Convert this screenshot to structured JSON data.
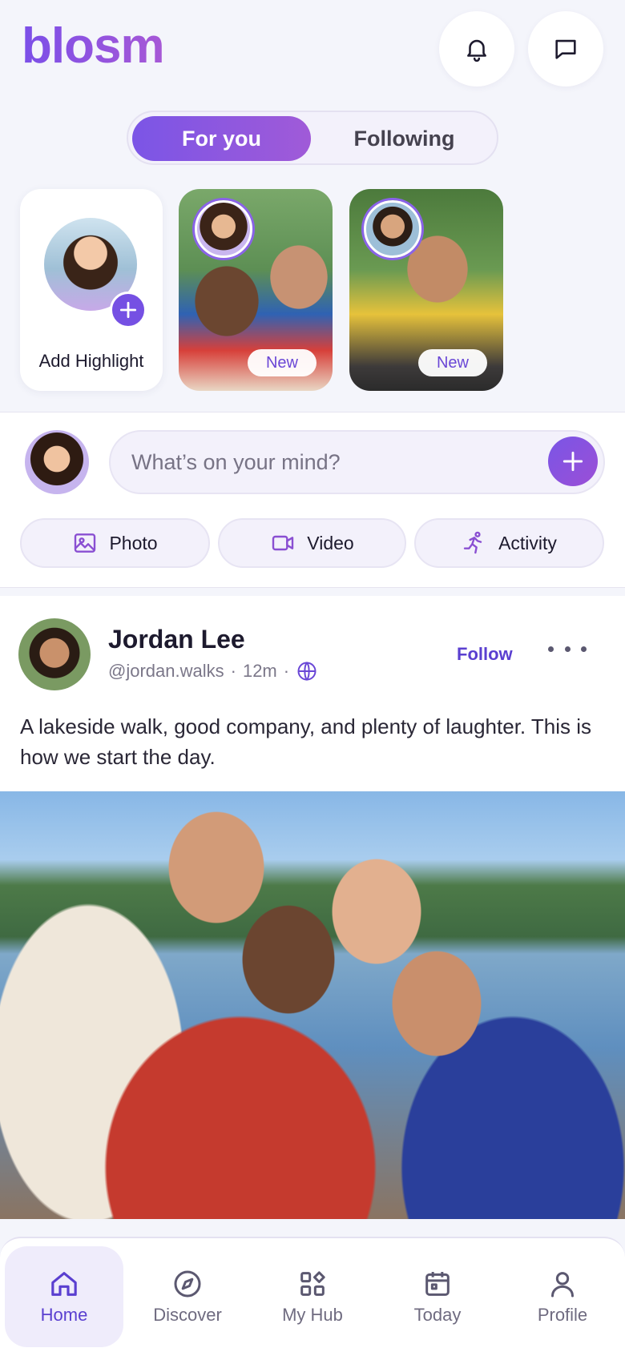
{
  "app": {
    "name": "blosm"
  },
  "header": {
    "notifications_icon": "bell-icon",
    "messages_icon": "chat-bubble-icon"
  },
  "feed_tabs": [
    {
      "label": "For you",
      "active": true
    },
    {
      "label": "Following",
      "active": false
    }
  ],
  "highlights": {
    "add_label": "Add Highlight",
    "stories": [
      {
        "badge": "New"
      },
      {
        "badge": "New"
      }
    ]
  },
  "composer": {
    "placeholder": "What’s on your mind?",
    "actions": [
      {
        "label": "Photo",
        "icon": "image-icon"
      },
      {
        "label": "Video",
        "icon": "video-camera-icon"
      },
      {
        "label": "Activity",
        "icon": "running-person-icon"
      }
    ]
  },
  "post": {
    "author_name": "Jordan Lee",
    "handle": "@jordan.walks",
    "time": "12m",
    "visibility_icon": "globe-icon",
    "follow_label": "Follow",
    "text": "A lakeside walk, good company, and plenty of laughter. This is how we start the day."
  },
  "bottom_nav": [
    {
      "label": "Home",
      "icon": "home-icon",
      "active": true
    },
    {
      "label": "Discover",
      "icon": "compass-icon",
      "active": false
    },
    {
      "label": "My Hub",
      "icon": "grid-icon",
      "active": false
    },
    {
      "label": "Today",
      "icon": "calendar-icon",
      "active": false
    },
    {
      "label": "Profile",
      "icon": "person-icon",
      "active": false
    }
  ],
  "colors": {
    "accent": "#7550e3",
    "accent_dark": "#5a3fd0",
    "background": "#f4f5fb"
  }
}
